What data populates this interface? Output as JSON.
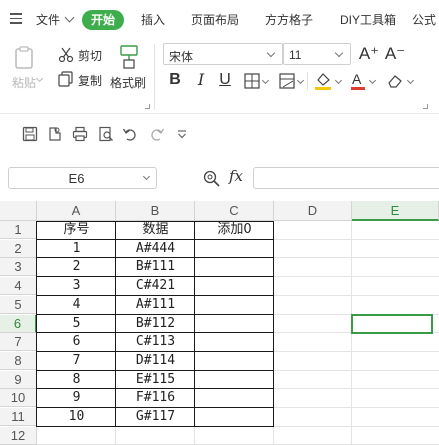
{
  "menu": {
    "file_label": "文件",
    "tabs": [
      "开始",
      "插入",
      "页面布局",
      "方方格子",
      "DIY工具箱",
      "公式"
    ]
  },
  "ribbon": {
    "paste_label": "粘贴",
    "cut_label": "剪切",
    "copy_label": "复制",
    "format_painter_label": "格式刷",
    "font_name": "宋体",
    "font_size": "11",
    "grow_font": "A⁺",
    "shrink_font": "A⁻",
    "bold": "B",
    "italic": "I",
    "underline": "U",
    "font_color_accent": "#e03c31",
    "fill_color_accent": "#f2c811"
  },
  "formula_bar": {
    "name_box": "E6",
    "fx_label": "fx",
    "formula_value": ""
  },
  "sheet": {
    "columns": [
      "A",
      "B",
      "C",
      "D",
      "E"
    ],
    "active_column": "E",
    "rows": [
      "1",
      "2",
      "3",
      "4",
      "5",
      "6",
      "7",
      "8",
      "9",
      "10",
      "11",
      "12"
    ],
    "active_row": "6",
    "active_cell": "E6",
    "header": [
      "序号",
      "数据",
      "添加0"
    ],
    "data": [
      [
        "1",
        "A#444",
        ""
      ],
      [
        "2",
        "B#111",
        ""
      ],
      [
        "3",
        "C#421",
        ""
      ],
      [
        "4",
        "A#111",
        ""
      ],
      [
        "5",
        "B#112",
        ""
      ],
      [
        "6",
        "C#113",
        ""
      ],
      [
        "7",
        "D#114",
        ""
      ],
      [
        "8",
        "E#115",
        ""
      ],
      [
        "9",
        "F#116",
        ""
      ],
      [
        "10",
        "G#117",
        ""
      ]
    ],
    "accent": "#3a9b46"
  }
}
